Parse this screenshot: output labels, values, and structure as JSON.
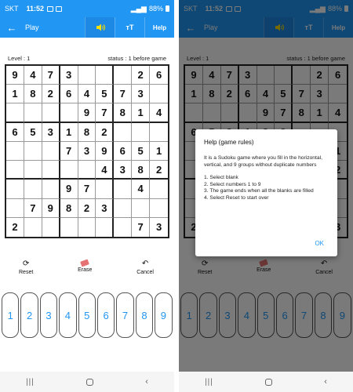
{
  "status_bar": {
    "carrier": "SKT",
    "time": "11:52",
    "battery": "88%"
  },
  "app_bar": {
    "title": "Play",
    "font_button": "ᴛT",
    "help_label": "Help"
  },
  "game": {
    "level": "Level : 1",
    "status": "status : 1 before game"
  },
  "board": [
    [
      "9",
      "4",
      "7",
      "3",
      "",
      "",
      "",
      "2",
      "6"
    ],
    [
      "1",
      "8",
      "2",
      "6",
      "4",
      "5",
      "7",
      "3",
      ""
    ],
    [
      "",
      "",
      "",
      "",
      "9",
      "7",
      "8",
      "1",
      "4"
    ],
    [
      "6",
      "5",
      "3",
      "1",
      "8",
      "2",
      "",
      "",
      ""
    ],
    [
      "",
      "",
      "",
      "7",
      "3",
      "9",
      "6",
      "5",
      "1"
    ],
    [
      "",
      "",
      "",
      "",
      "",
      "4",
      "3",
      "8",
      "2"
    ],
    [
      "",
      "",
      "",
      "9",
      "7",
      "",
      "",
      "4",
      ""
    ],
    [
      "",
      "7",
      "9",
      "8",
      "2",
      "3",
      "",
      "",
      ""
    ],
    [
      "2",
      "",
      "",
      "",
      "",
      "",
      "",
      "7",
      "3"
    ]
  ],
  "actions": {
    "reset": "Reset",
    "erase": "Erase",
    "cancel": "Cancel"
  },
  "numpad": [
    "1",
    "2",
    "3",
    "4",
    "5",
    "6",
    "7",
    "8",
    "9"
  ],
  "help_dialog": {
    "title": "Help (game rules)",
    "intro": "It is a Sudoku game where you fill in the horizontal, vertical, and 9 groups without duplicate numbers",
    "steps": [
      "1. Select blank",
      "2. Select numbers 1 to 9",
      "3. The game ends when all the blanks are filled",
      "4. Select Reset to start over"
    ],
    "ok_label": "OK"
  },
  "colors": {
    "primary": "#2196f3",
    "sound_icon": "#f9e000",
    "erase_icon": "#e57373"
  }
}
